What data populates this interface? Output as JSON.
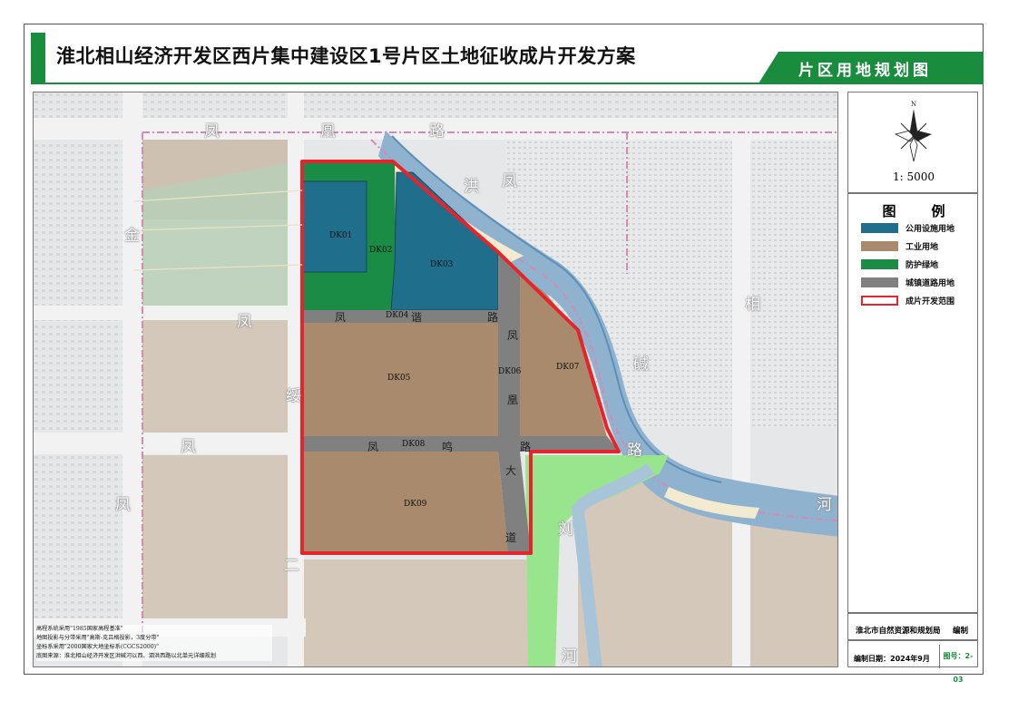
{
  "title": "淮北相山经济开发区西片集中建设区1号片区土地征收成片开发方案",
  "subtitle": "片区用地规划图",
  "map": {
    "north_label": "N",
    "scale": "1: 5000",
    "parcels": [
      "DK01",
      "DK02",
      "DK03",
      "DK04",
      "DK05",
      "DK06",
      "DK07",
      "DK08",
      "DK09"
    ],
    "road_labels_large": [
      "凤",
      "凰",
      "路",
      "洪",
      "凤",
      "金",
      "凤",
      "相",
      "绥",
      "碱",
      "凤",
      "路",
      "凤",
      "河",
      "刘",
      "二",
      "河"
    ],
    "road_labels_small": [
      "凤",
      "谐",
      "路",
      "凤",
      "凰",
      "凤",
      "鸣",
      "路",
      "大",
      "道"
    ],
    "notes": [
      "高程系统采用\"1985国家高程基准\"",
      "地图投影与分带采用\"高斯-克吕格投影，3度分带\"",
      "坐标系采用\"2000国家大地坐标系(CGCS2000)\"",
      "底图来源：淮北相山经济开发区洪碱河以西、泗洪西路以北单元详细规划"
    ]
  },
  "legend": {
    "title_left": "图",
    "title_right": "例",
    "items": [
      {
        "label": "公用设施用地",
        "color": "#1f6e8c"
      },
      {
        "label": "工业用地",
        "color": "#a98a6c"
      },
      {
        "label": "防护绿地",
        "color": "#1a8c45"
      },
      {
        "label": "城镇道路用地",
        "color": "#808080"
      },
      {
        "label": "成片开发范围",
        "color": "#e5242b"
      }
    ]
  },
  "footer": {
    "org": "淮北市自然资源和规划局",
    "org_action": "编制",
    "date": "编制日期：2024年9月",
    "figure_no": "图号：2-03"
  },
  "colors": {
    "accent": "#1a8c3e",
    "boundary": "#e5242b",
    "utility": "#1f6e8c",
    "industrial": "#a98a6c",
    "green": "#1a8c45",
    "road": "#808080",
    "river": "#7da9c6"
  }
}
